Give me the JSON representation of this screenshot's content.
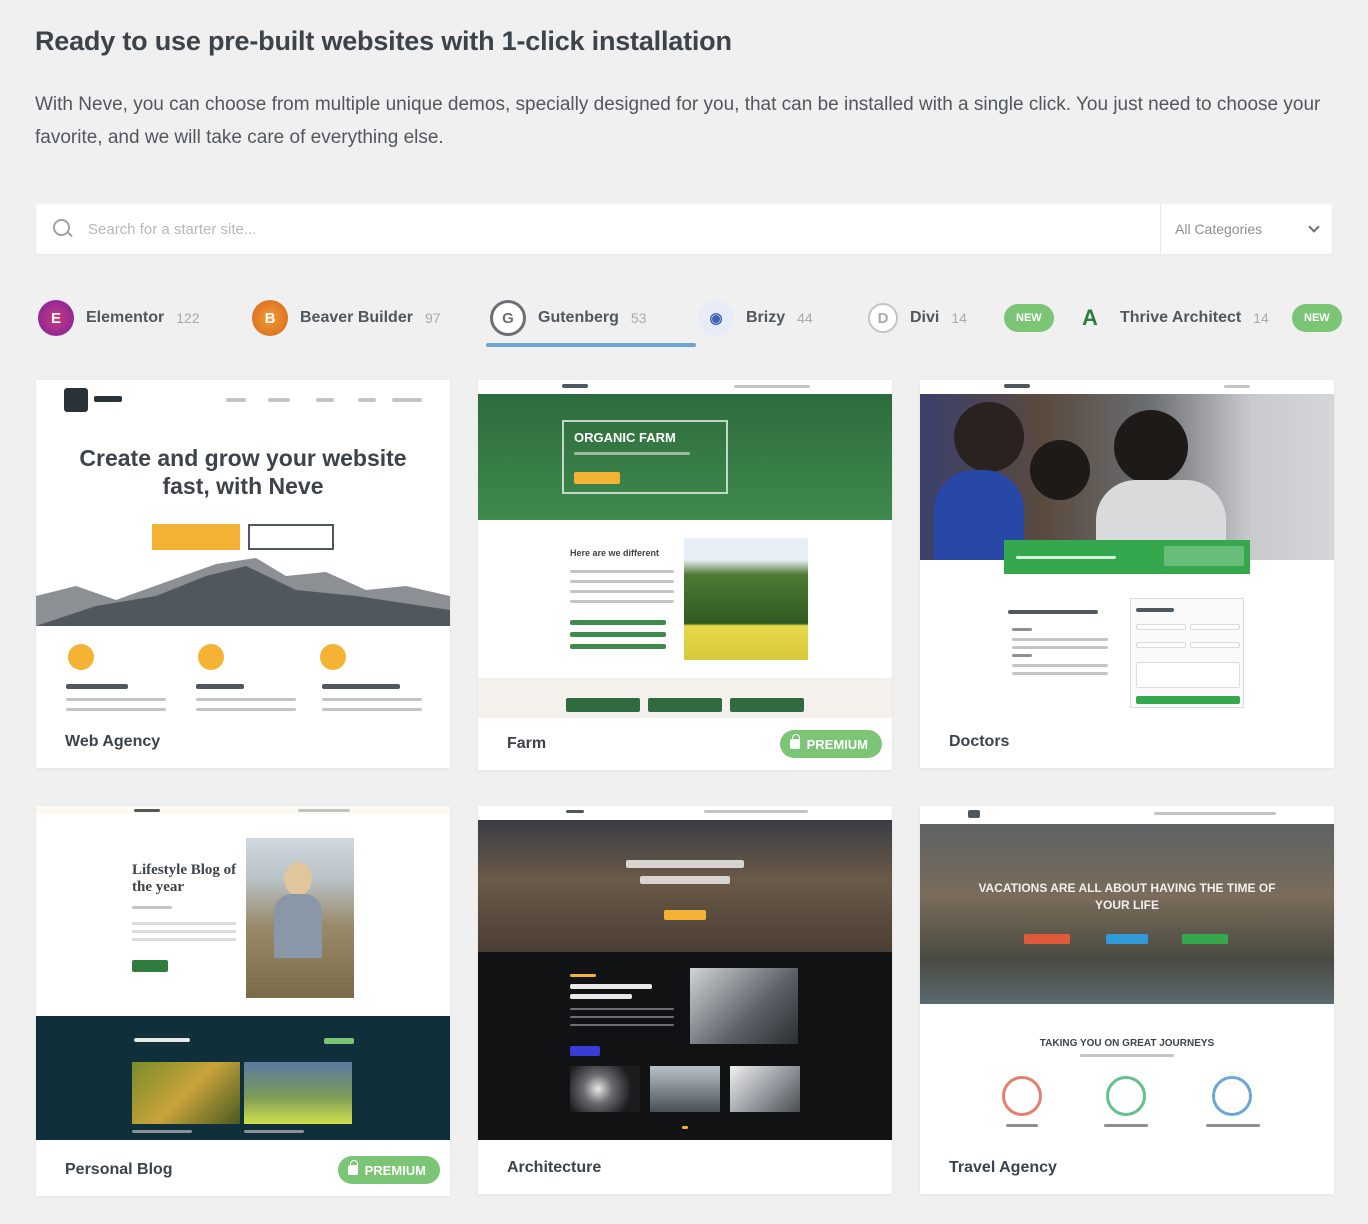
{
  "heading": "Ready to use pre-built websites with 1-click installation",
  "description": "With Neve, you can choose from multiple unique demos, specially designed for you, that can be installed with a single click. You just need to choose your favorite, and we will take care of everything else.",
  "search": {
    "placeholder": "Search for a starter site...",
    "category_selected": "All Categories"
  },
  "builders": [
    {
      "label": "Elementor",
      "count": "122",
      "icon": "elementor-icon",
      "color": "#92003b"
    },
    {
      "label": "Beaver Builder",
      "count": "97",
      "icon": "beaver-builder-icon",
      "color": "#e87f29"
    },
    {
      "label": "Gutenberg",
      "count": "53",
      "icon": "gutenberg-icon",
      "color": "#50575e"
    },
    {
      "label": "Brizy",
      "count": "44",
      "icon": "brizy-icon",
      "color": "#4064b5"
    },
    {
      "label": "Divi",
      "count": "14",
      "icon": "divi-icon",
      "color": "#a7aaad"
    },
    {
      "label": "Thrive Architect",
      "count": "14",
      "icon": "thrive-architect-icon",
      "color": "#2f7d3d"
    }
  ],
  "new_badge": "NEW",
  "premium_label": "PREMIUM",
  "sites": [
    {
      "title": "Web Agency",
      "premium": false
    },
    {
      "title": "Farm",
      "premium": true
    },
    {
      "title": "Doctors",
      "premium": false
    },
    {
      "title": "Personal Blog",
      "premium": true
    },
    {
      "title": "Architecture",
      "premium": false
    },
    {
      "title": "Travel Agency",
      "premium": false
    }
  ],
  "previews": {
    "web_agency_hero": "Create and grow your website fast, with Neve",
    "farm_hero": "ORGANIC FARM",
    "farm_sub": "Here are we different",
    "blog_hero": "Lifestyle Blog of the year",
    "travel_hero": "VACATIONS ARE ALL ABOUT HAVING THE TIME OF YOUR LIFE",
    "travel_sub": "TAKING YOU ON GREAT JOURNEYS"
  },
  "colors": {
    "accent": "#6ba4d8",
    "premium": "#7cc576",
    "agency_btn": "#f5b335"
  }
}
